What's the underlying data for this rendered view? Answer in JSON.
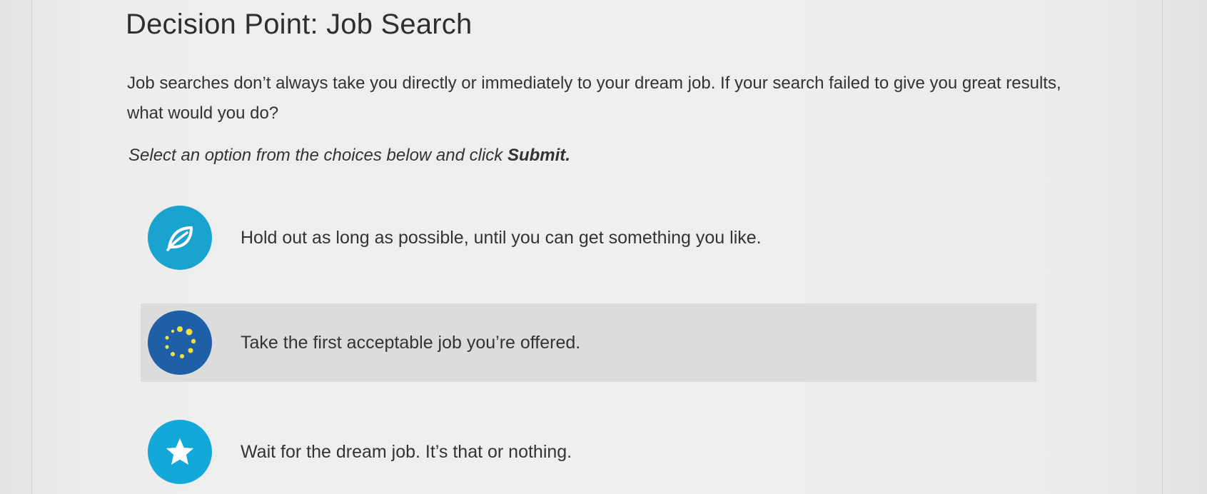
{
  "page": {
    "title": "Decision Point: Job Search",
    "intro": "Job searches don’t always take you directly or immediately to your dream job. If your search failed to give you great results, what would you do?",
    "instruction_prefix": "Select an option from the choices below and click ",
    "instruction_bold": "Submit."
  },
  "options": [
    {
      "label": "Hold out as long as possible, until you can get something you like.",
      "icon": "leaf-icon",
      "color": "#1aa3cf",
      "selected": false
    },
    {
      "label": "Take the first acceptable job you’re offered.",
      "icon": "dots-circle-icon",
      "color": "#1f5fa8",
      "selected": true
    },
    {
      "label": "Wait for the dream job. It’s that or nothing.",
      "icon": "star-icon",
      "color": "#14a8d9",
      "selected": false
    }
  ]
}
